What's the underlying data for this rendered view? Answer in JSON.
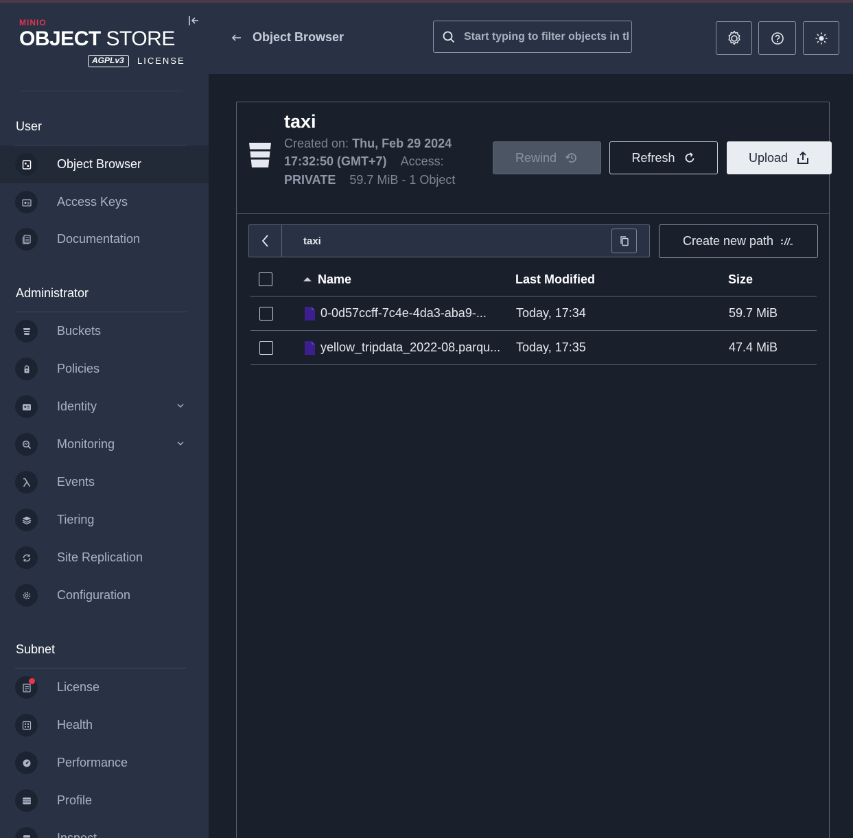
{
  "brand": {
    "minio": "MINIO",
    "store_bold": "OBJECT",
    "store_light": " STORE",
    "agpl": "AGPLv3",
    "license": "LICENSE"
  },
  "sidebar": {
    "sections": [
      {
        "title": "User",
        "items": [
          {
            "label": "Object Browser",
            "icon": "object-browser-icon",
            "active": true
          },
          {
            "label": "Access Keys",
            "icon": "access-keys-icon"
          },
          {
            "label": "Documentation",
            "icon": "documentation-icon"
          }
        ]
      },
      {
        "title": "Administrator",
        "items": [
          {
            "label": "Buckets",
            "icon": "bucket-icon"
          },
          {
            "label": "Policies",
            "icon": "lock-icon"
          },
          {
            "label": "Identity",
            "icon": "identity-icon",
            "expandable": true
          },
          {
            "label": "Monitoring",
            "icon": "monitoring-icon",
            "expandable": true
          },
          {
            "label": "Events",
            "icon": "lambda-icon"
          },
          {
            "label": "Tiering",
            "icon": "layers-icon"
          },
          {
            "label": "Site Replication",
            "icon": "replication-icon"
          },
          {
            "label": "Configuration",
            "icon": "gear-icon"
          }
        ]
      },
      {
        "title": "Subnet",
        "items": [
          {
            "label": "License",
            "icon": "license-icon",
            "badge": "red-dot"
          },
          {
            "label": "Health",
            "icon": "health-icon"
          },
          {
            "label": "Performance",
            "icon": "performance-icon"
          },
          {
            "label": "Profile",
            "icon": "profile-icon"
          },
          {
            "label": "Inspect",
            "icon": "inspect-icon"
          }
        ]
      }
    ]
  },
  "header": {
    "title": "Object Browser",
    "search_placeholder": "Start typing to filter objects in the bucket",
    "buttons": [
      "settings-icon",
      "help-icon",
      "theme-toggle-icon"
    ]
  },
  "bucket": {
    "name": "taxi",
    "created_label": "Created on:",
    "created_value": "Thu, Feb 29 2024 17:32:50 (GMT+7)",
    "access_label": "Access:",
    "access_value": "PRIVATE",
    "size_summary": "59.7 MiB - 1 Object"
  },
  "actions": {
    "rewind": "Rewind",
    "refresh": "Refresh",
    "upload": "Upload"
  },
  "path": {
    "crumb": "taxi",
    "new_path_label": "Create new path"
  },
  "table": {
    "columns": [
      "Name",
      "Last Modified",
      "Size"
    ],
    "rows": [
      {
        "name": "0-0d57ccff-7c4e-4da3-aba9-...",
        "modified": "Today, 17:34",
        "size": "59.7 MiB"
      },
      {
        "name": "yellow_tripdata_2022-08.parqu...",
        "modified": "Today, 17:35",
        "size": "47.4 MiB"
      }
    ]
  },
  "colors": {
    "sidebar_bg": "#283244",
    "main_bg": "#19202b",
    "brand_red": "#e0344f",
    "file_icon": "#3b1f8f"
  }
}
